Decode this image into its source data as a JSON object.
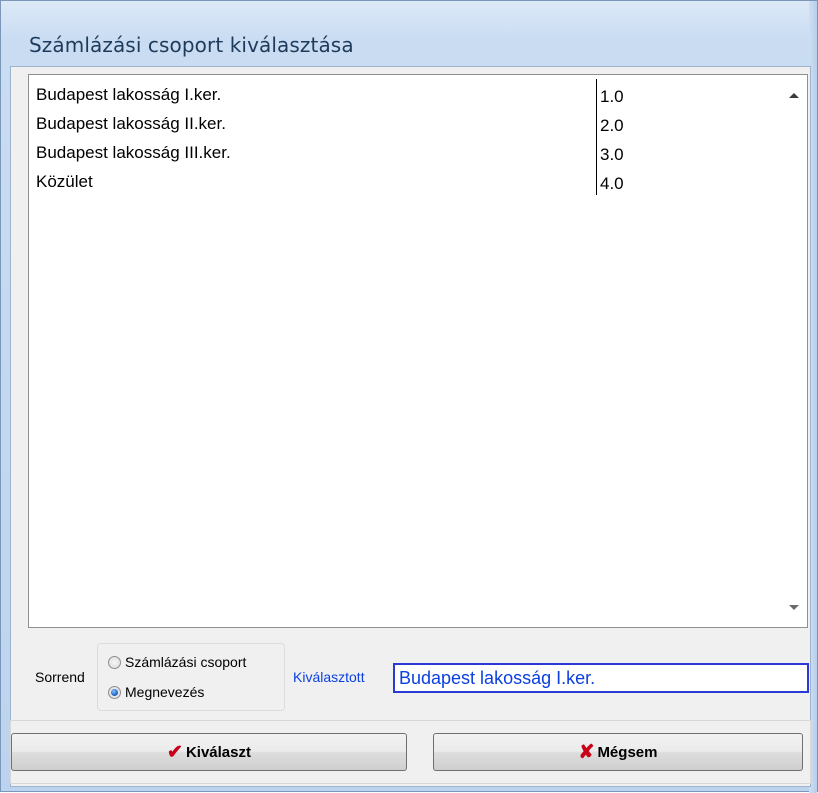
{
  "dialog": {
    "title": "Számlázási csoport kiválasztása"
  },
  "list": {
    "rows": [
      {
        "name": "Budapest lakosság I.ker.",
        "code": "1.0"
      },
      {
        "name": "Budapest lakosság II.ker.",
        "code": "2.0"
      },
      {
        "name": "Budapest lakosság III.ker.",
        "code": "3.0"
      },
      {
        "name": "Közület",
        "code": "4.0"
      }
    ]
  },
  "sort": {
    "label": "Sorrend",
    "options": [
      {
        "label": "Számlázási csoport",
        "checked": false
      },
      {
        "label": "Megnevezés",
        "checked": true
      }
    ]
  },
  "selected": {
    "label": "Kiválasztott",
    "value": "Budapest lakosság I.ker."
  },
  "buttons": {
    "ok_label": "Kiválaszt",
    "ok_icon": "check-icon",
    "cancel_label": "Mégsem",
    "cancel_icon": "x-icon"
  },
  "colors": {
    "accent_blue": "#0a3fe0",
    "icon_red": "#c8001a"
  }
}
